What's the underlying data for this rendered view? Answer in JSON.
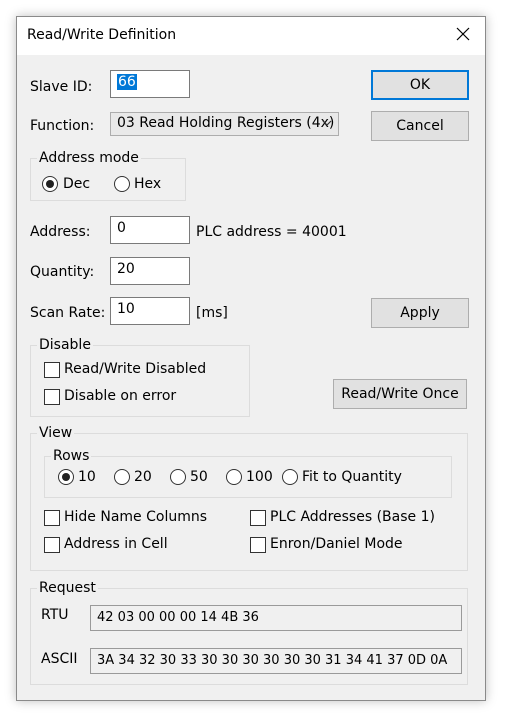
{
  "window": {
    "title": "Read/Write Definition"
  },
  "slave_id": {
    "label": "Slave ID:",
    "value": "66"
  },
  "function": {
    "label": "Function:",
    "value": "03 Read Holding Registers (4x)"
  },
  "address_mode": {
    "title": "Address mode",
    "dec": "Dec",
    "hex": "Hex",
    "selected": "Dec"
  },
  "address": {
    "label": "Address:",
    "value": "0",
    "plc_text": "PLC address = 40001"
  },
  "quantity": {
    "label": "Quantity:",
    "value": "20"
  },
  "scan_rate": {
    "label": "Scan Rate:",
    "value": "10",
    "unit": "[ms]"
  },
  "buttons": {
    "ok": "OK",
    "cancel": "Cancel",
    "apply": "Apply",
    "rw_once": "Read/Write Once"
  },
  "disable": {
    "title": "Disable",
    "rw_disabled": "Read/Write Disabled",
    "on_error": "Disable on error"
  },
  "view": {
    "title": "View",
    "rows_title": "Rows",
    "rows": [
      "10",
      "20",
      "50",
      "100",
      "Fit to Quantity"
    ],
    "rows_selected": "10",
    "hide_name": "Hide Name Columns",
    "plc_addresses": "PLC Addresses (Base 1)",
    "address_in_cell": "Address in Cell",
    "enron": "Enron/Daniel Mode"
  },
  "request": {
    "title": "Request",
    "rtu_label": "RTU",
    "rtu_value": "42 03 00 00 00 14 4B 36",
    "ascii_label": "ASCII",
    "ascii_value": "3A 34 32 30 33 30 30 30 30 30 30 31 34 41 37 0D 0A"
  },
  "icons": [
    "close-icon",
    "chevron-down-icon"
  ]
}
